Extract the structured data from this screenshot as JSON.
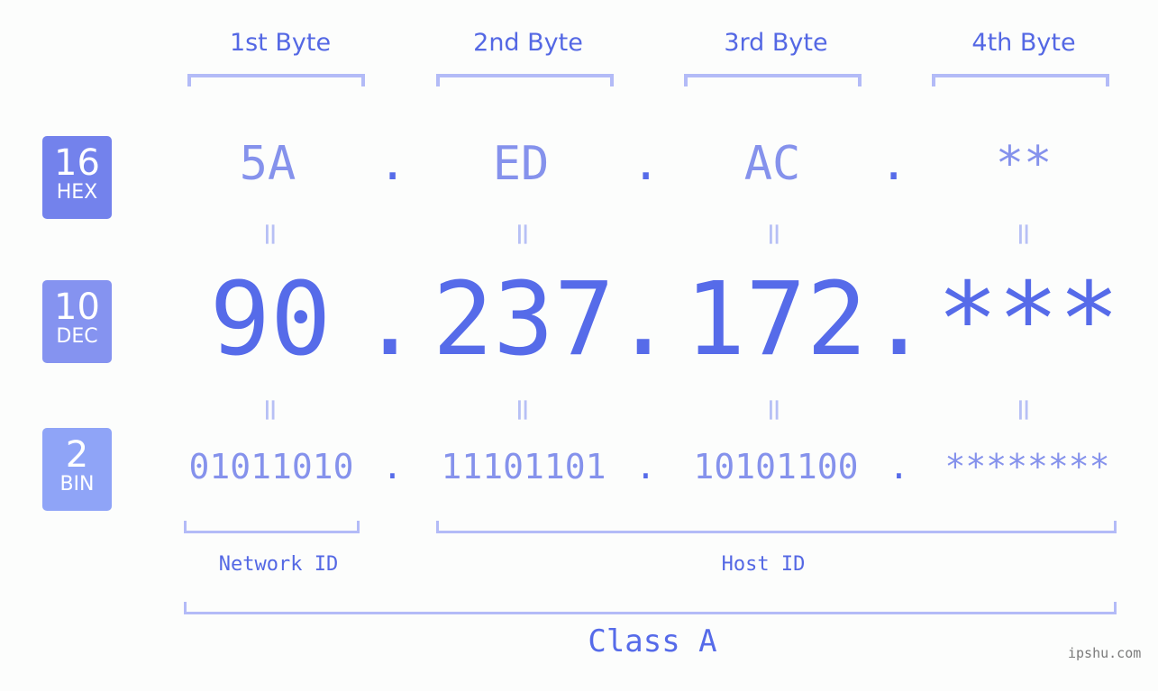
{
  "byte_headers": [
    "1st Byte",
    "2nd Byte",
    "3rd Byte",
    "4th Byte"
  ],
  "badges": [
    {
      "num": "16",
      "unit": "HEX",
      "color": "#7382ec"
    },
    {
      "num": "10",
      "unit": "DEC",
      "color": "#8593f0"
    },
    {
      "num": "2",
      "unit": "BIN",
      "color": "#8fa4f7"
    }
  ],
  "hex": [
    "5A",
    "ED",
    "AC",
    "**"
  ],
  "dec": [
    "90",
    "237",
    "172",
    "***"
  ],
  "bin": [
    "01011010",
    "11101101",
    "10101100",
    "********"
  ],
  "separator": ".",
  "equals": "=",
  "network_label": "Network ID",
  "host_label": "Host ID",
  "class_label": "Class A",
  "watermark": "ipshu.com",
  "colors": {
    "accent": "#566be9",
    "light": "#8592ec",
    "bracket": "#b3bbf7",
    "watermark": "#7a7a7a"
  }
}
